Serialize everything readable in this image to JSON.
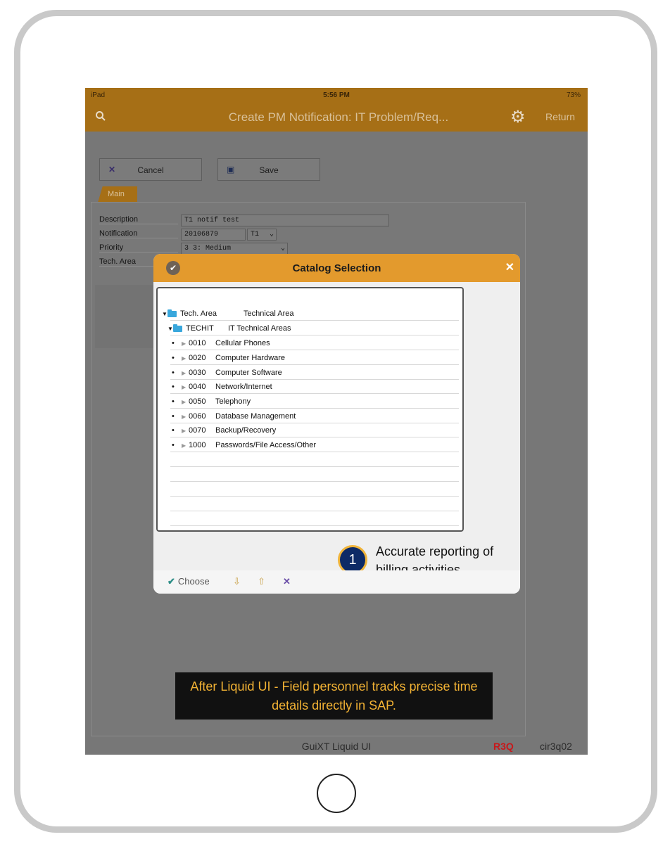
{
  "status_bar": {
    "device": "iPad",
    "time": "5:56 PM",
    "battery": "73%"
  },
  "header": {
    "title": "Create PM Notification: IT Problem/Req...",
    "return_label": "Return",
    "search_icon": "search-icon",
    "settings_icon": "gear-icon"
  },
  "toolbar": {
    "cancel_label": "Cancel",
    "save_label": "Save"
  },
  "tabs": [
    {
      "label": "Main"
    }
  ],
  "form": {
    "description_label": "Description",
    "description_value": "T1 notif test",
    "notification_label": "Notification",
    "notification_value": "20106879",
    "notification_type": "T1",
    "priority_label": "Priority",
    "priority_value": "3 3: Medium",
    "tech_area_label": "Tech. Area"
  },
  "dialog": {
    "title": "Catalog Selection",
    "tree": {
      "root": {
        "code": "Tech. Area",
        "text": "Technical Area"
      },
      "group": {
        "code": "TECHIT",
        "text": "IT Technical Areas"
      },
      "items": [
        {
          "code": "0010",
          "text": "Cellular Phones"
        },
        {
          "code": "0020",
          "text": "Computer Hardware"
        },
        {
          "code": "0030",
          "text": "Computer Software"
        },
        {
          "code": "0040",
          "text": "Network/Internet"
        },
        {
          "code": "0050",
          "text": "Telephony"
        },
        {
          "code": "0060",
          "text": "Database Management"
        },
        {
          "code": "0070",
          "text": "Backup/Recovery"
        },
        {
          "code": "1000",
          "text": "Passwords/File Access/Other"
        }
      ]
    },
    "choose_label": "Choose"
  },
  "callout": {
    "number": "1",
    "text": "Accurate reporting of billing activities"
  },
  "banner": {
    "text": "After Liquid UI - Field personnel tracks precise time details directly in SAP."
  },
  "footer": {
    "app_name": "GuiXT Liquid UI",
    "system": "R3Q",
    "client": "cir3q02"
  },
  "colors": {
    "header": "#a66f16",
    "dialog_header": "#e39a2d",
    "banner_text": "#f2b234",
    "callout_badge": "#0d2a66"
  }
}
